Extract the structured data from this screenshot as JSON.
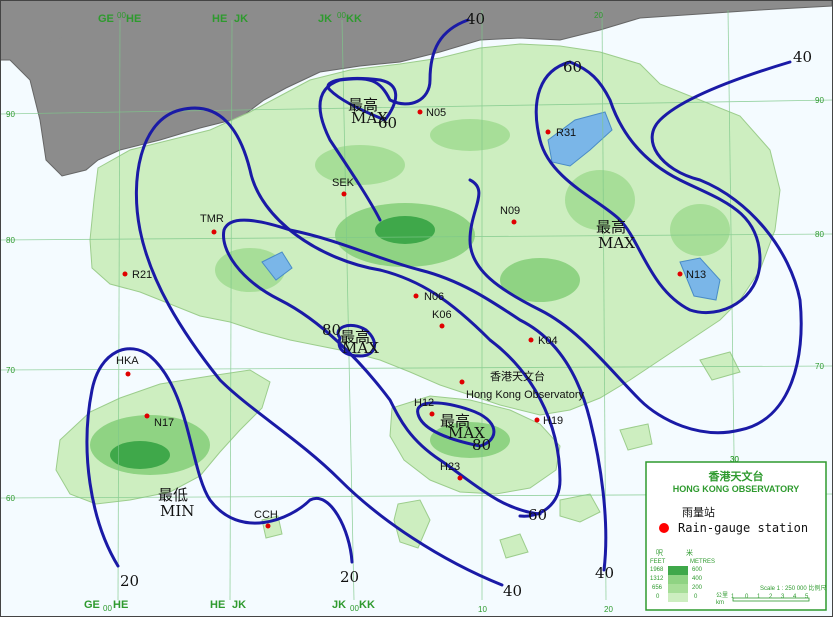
{
  "grid_labels": {
    "top": [
      "GE",
      "00",
      "HE",
      "HE",
      "JK",
      "JK",
      "00",
      "KK",
      "20"
    ],
    "bottom": [
      "GE",
      "00",
      "HE",
      "HE",
      "JK",
      "JK",
      "00",
      "KK",
      "10",
      "20",
      "30"
    ],
    "left": [
      "90",
      "80",
      "70",
      "60"
    ],
    "right": [
      "90",
      "80",
      "70",
      "60"
    ],
    "inner": [
      "30"
    ]
  },
  "stations": [
    {
      "id": "N05",
      "label": "N05"
    },
    {
      "id": "R31",
      "label": "R31"
    },
    {
      "id": "SEK",
      "label": "SEK"
    },
    {
      "id": "N09",
      "label": "N09"
    },
    {
      "id": "TMR",
      "label": "TMR"
    },
    {
      "id": "R21",
      "label": "R21"
    },
    {
      "id": "N13",
      "label": "N13"
    },
    {
      "id": "N06",
      "label": "N06"
    },
    {
      "id": "K06",
      "label": "K06"
    },
    {
      "id": "K04",
      "label": "K04"
    },
    {
      "id": "HKA",
      "label": "HKA"
    },
    {
      "id": "N17",
      "label": "N17"
    },
    {
      "id": "H12",
      "label": "H12"
    },
    {
      "id": "H19",
      "label": "H19"
    },
    {
      "id": "H23",
      "label": "H23"
    },
    {
      "id": "CCH",
      "label": "CCH"
    },
    {
      "id": "HKO",
      "label": ""
    }
  ],
  "hko_label": {
    "zh": "香港天文台",
    "en": "Hong Kong Observatory"
  },
  "isohyet_labels": [
    {
      "id": "i40a",
      "text": "40"
    },
    {
      "id": "i40b",
      "text": "40"
    },
    {
      "id": "i40c",
      "text": "40"
    },
    {
      "id": "i40d",
      "text": "40"
    },
    {
      "id": "i60a",
      "text": "60"
    },
    {
      "id": "i60b",
      "text": "60"
    },
    {
      "id": "i60c",
      "text": "60"
    },
    {
      "id": "i80a",
      "text": "80"
    },
    {
      "id": "i80b",
      "text": "80"
    },
    {
      "id": "i20a",
      "text": "20"
    },
    {
      "id": "i20b",
      "text": "20"
    }
  ],
  "extrema_labels": [
    {
      "id": "max1",
      "zh": "最高",
      "en": "MAX"
    },
    {
      "id": "max2",
      "zh": "最高",
      "en": "MAX"
    },
    {
      "id": "max3",
      "zh": "最高",
      "en": "MAX"
    },
    {
      "id": "max4",
      "zh": "最高",
      "en": "MAX"
    },
    {
      "id": "min1",
      "zh": "最低",
      "en": "MIN"
    }
  ],
  "legend": {
    "title_zh": "香港天文台",
    "title_en": "HONG KONG OBSERVATORY",
    "gauge_zh": "雨量站",
    "gauge_en": "Rain-gauge station",
    "elev_header_zh_left": "呎",
    "elev_header_zh_right": "米",
    "elev_header_left": "FEET",
    "elev_header_right": "METRES",
    "elev_rows": [
      {
        "feet": "1968",
        "metres": "600"
      },
      {
        "feet": "1312",
        "metres": "400"
      },
      {
        "feet": "656",
        "metres": "200"
      },
      {
        "feet": "0",
        "metres": "0"
      }
    ],
    "scale_text": "Scale 1 : 250 000  比例尺",
    "scale_unit_zh": "公里",
    "scale_unit_en": "km",
    "scale_ticks": [
      "1",
      "0",
      "1",
      "2",
      "3",
      "4",
      "5"
    ],
    "marker_color": "#ff0000",
    "contour_color": "#1a1aa6"
  }
}
